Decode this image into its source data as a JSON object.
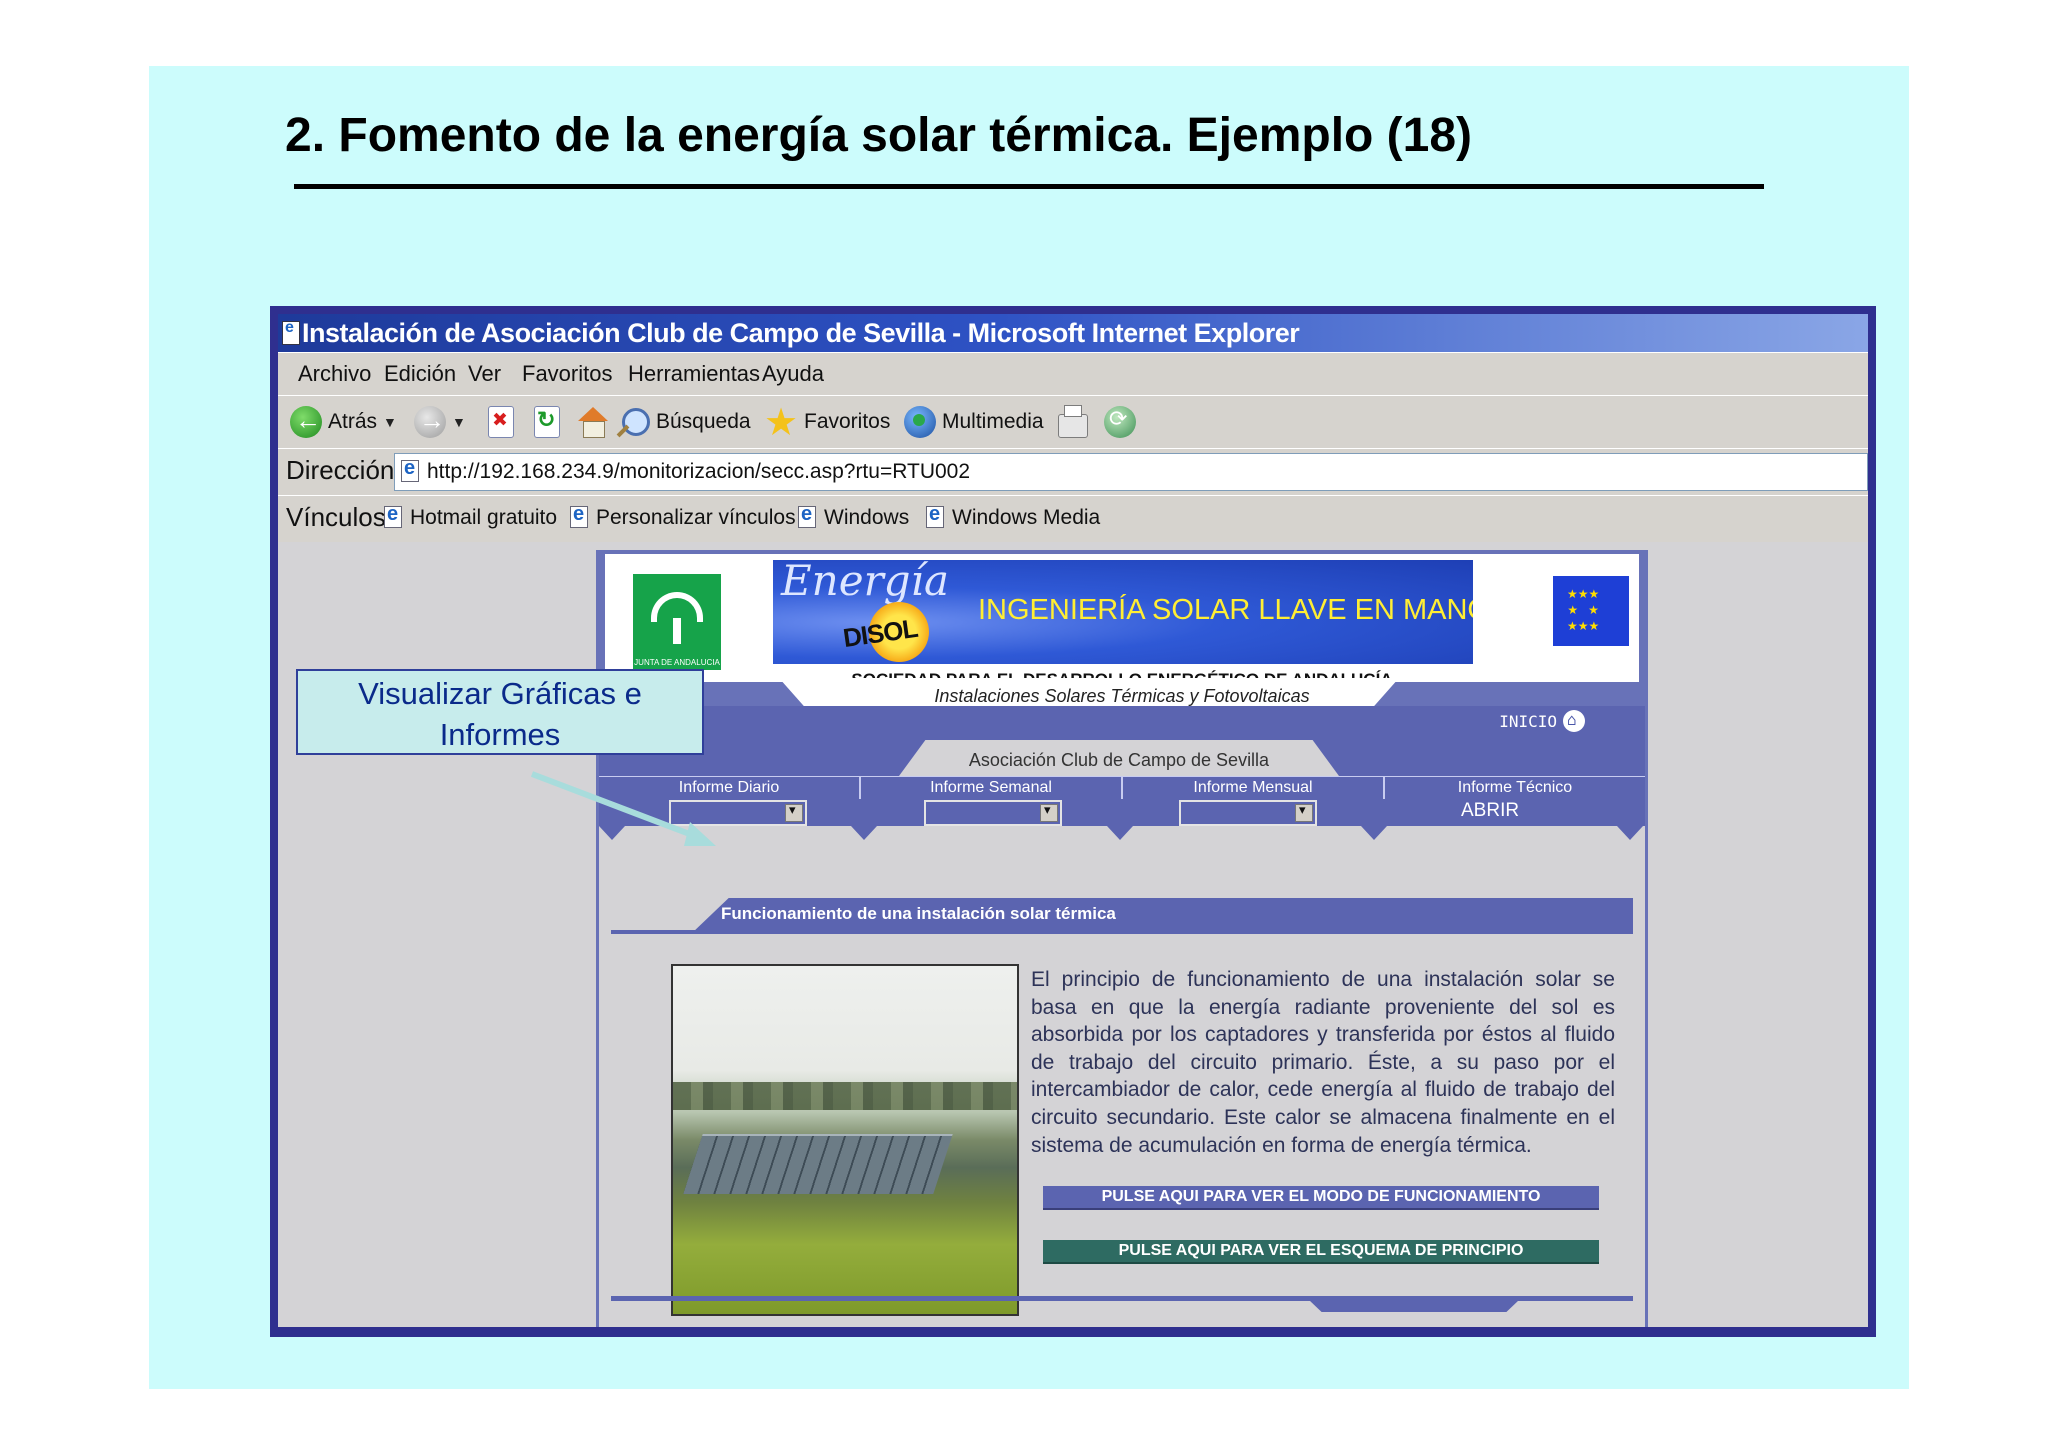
{
  "slide": {
    "title": "2.  Fomento de la  energía solar térmica. Ejemplo (18)"
  },
  "callout": {
    "text": "Visualizar Gráficas e Informes"
  },
  "browser": {
    "window_title": "Instalación de Asociación Club de Campo de Sevilla - Microsoft Internet Explorer",
    "menu": [
      "Archivo",
      "Edición",
      "Ver",
      "Favoritos",
      "Herramientas",
      "Ayuda"
    ],
    "toolbar": {
      "back": "Atrás",
      "search": "Búsqueda",
      "favorites": "Favoritos",
      "media": "Multimedia"
    },
    "address": {
      "label": "Dirección",
      "url": "http://192.168.234.9/monitorizacion/secc.asp?rtu=RTU002"
    },
    "links": {
      "label": "Vínculos",
      "items": [
        "Hotmail gratuito",
        "Personalizar vínculos",
        "Windows",
        "Windows Media"
      ]
    }
  },
  "page": {
    "banner": {
      "junta_text": "JUNTA DE ANDALUCIA",
      "energia": "Energía",
      "disol": "DISOL",
      "slogan": "INGENIERÍA SOLAR LLAVE EN MANO",
      "society": "SOCIEDAD PARA EL DESARROLLO ENERGÉTICO DE ANDALUCÍA",
      "installations": "Instalaciones Solares Térmicas y Fotovoltaicas"
    },
    "nav": {
      "home": "INICIO",
      "club": "Asociación Club de Campo de Sevilla",
      "reports": [
        "Informe Diario",
        "Informe Semanal",
        "Informe Mensual",
        "Informe Técnico"
      ],
      "open": "ABRIR"
    },
    "section_title": "Funcionamiento de una instalación solar térmica",
    "description": "El principio de funcionamiento de una instalación solar se basa en que la energía radiante proveniente del sol es absorbida por los captadores y transferida por éstos al fluido de trabajo del circuito primario. Éste, a su paso por el intercambiador de calor, cede energía al fluido de trabajo del circuito secundario. Este calor se almacena finalmente en el sistema de acumulación en forma de energía térmica.",
    "buttons": {
      "mode": "PULSE AQUI PARA VER EL MODO DE FUNCIONAMIENTO",
      "scheme": "PULSE AQUI PARA VER EL ESQUEMA DE PRINCIPIO"
    }
  },
  "colors": {
    "slide_bg": "#ccfcfc",
    "nav_blue": "#5b64b0",
    "window_border": "#2f2f8f",
    "scheme_button": "#2e6b62"
  }
}
